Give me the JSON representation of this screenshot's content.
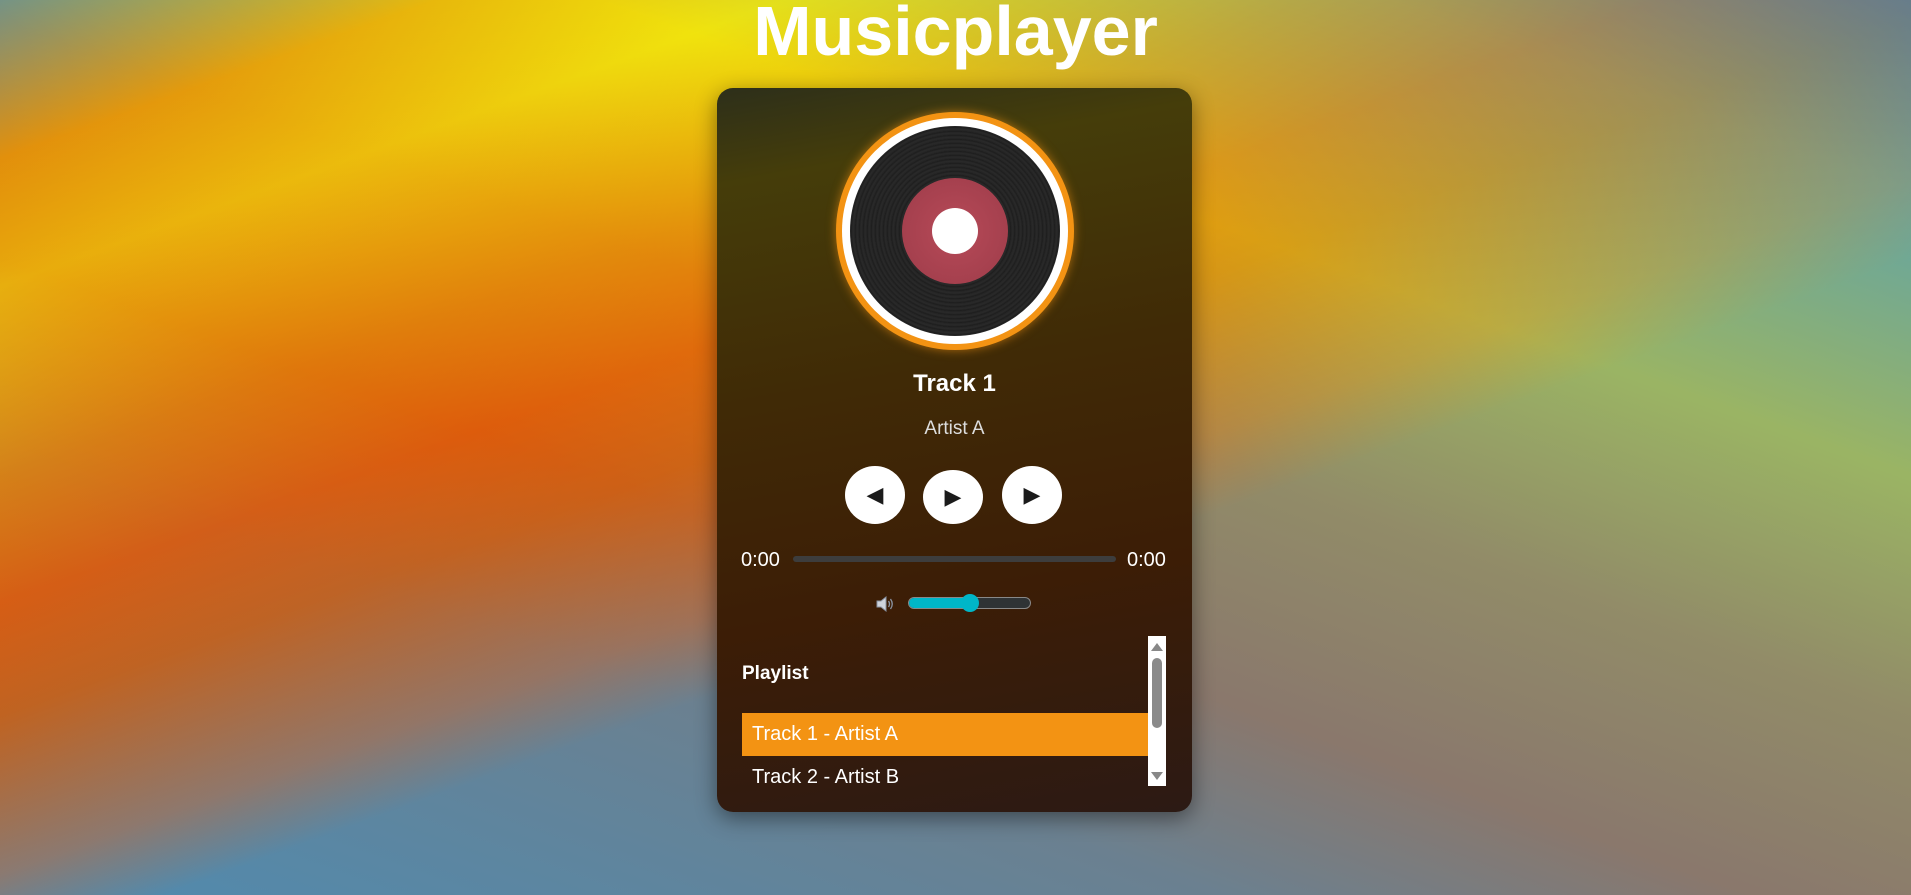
{
  "page": {
    "title": "Musicplayer"
  },
  "now_playing": {
    "title": "Track 1",
    "artist": "Artist A"
  },
  "controls": {
    "prev_symbol": "◀",
    "play_symbol": "▶",
    "next_symbol": "▶"
  },
  "progress": {
    "current_time": "0:00",
    "total_time": "0:00",
    "fraction": 0
  },
  "volume": {
    "level": 0.5,
    "icon": "speaker-icon"
  },
  "playlist": {
    "heading": "Playlist",
    "items": [
      {
        "label": "Track 1 - Artist A",
        "active": true
      },
      {
        "label": "Track 2 - Artist B",
        "active": false
      }
    ]
  },
  "colors": {
    "accent": "#f39313",
    "slider": "#00b6c8",
    "record_label": "#a5404e"
  }
}
